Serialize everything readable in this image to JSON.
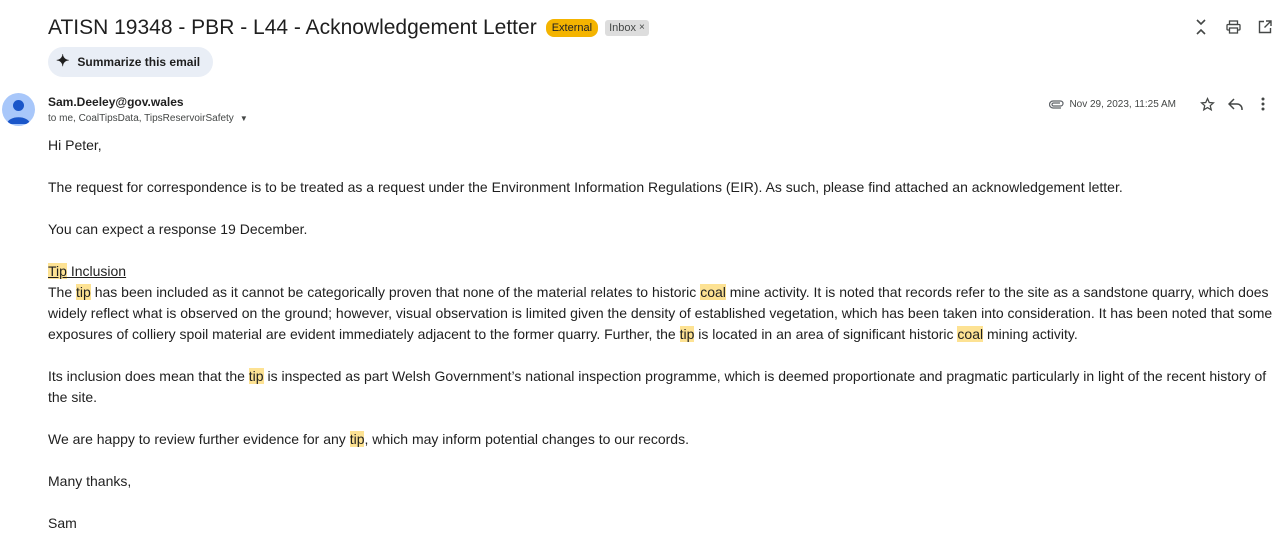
{
  "email": {
    "subject": "ATISN 19348 - PBR - L44 - Acknowledgement Letter",
    "labels": {
      "external": "External",
      "inbox": "Inbox",
      "inbox_remove": "×"
    },
    "summarize_label": "Summarize this email",
    "sender": "Sam.Deeley@gov.wales",
    "recipients": "to me, CoalTipsData, TipsReservoirSafety",
    "date": "Nov 29, 2023, 11:25 AM",
    "body": {
      "greeting": "Hi Peter,",
      "p1": "The request for correspondence is to be treated as a request under the Environment Information Regulations (EIR). As such, please find attached an acknowledgement letter.",
      "p2": "You can expect a response 19 December.",
      "heading_hl": "Tip",
      "heading_rest": " Inclusion",
      "p3": {
        "s1": "The ",
        "h1": "tip",
        "s2": " has been included as it cannot be categorically proven that none of the material relates to historic ",
        "h2": "coal",
        "s3": " mine activity. It is noted that records refer to the site as a sandstone quarry, which does widely reflect what is observed on the ground; however, visual observation is limited given the density of established vegetation, which has been taken into consideration. It has been noted that some exposures of colliery spoil material are evident immediately adjacent to the former quarry. Further, the ",
        "h3": "tip",
        "s4": " is located in an area of significant historic ",
        "h4": "coal",
        "s5": " mining activity."
      },
      "p4": {
        "s1": "Its inclusion does mean that the ",
        "h1": "tip",
        "s2": " is inspected as part Welsh Government’s national inspection programme, which is deemed proportionate and pragmatic particularly in light of the recent history of the site."
      },
      "p5": {
        "s1": "We are happy to review further evidence for any ",
        "h1": "tip",
        "s2": ", which may inform potential changes to our records."
      },
      "closing": "Many thanks,",
      "signature": "Sam"
    }
  },
  "colors": {
    "highlight": "#fde293",
    "external_badge": "#f4b400",
    "summarize_bg": "#e9eef6",
    "avatar": "#a8c7fa"
  },
  "icons": {
    "toolbar": [
      "collapse-all-icon",
      "print-icon",
      "open-in-new-window-icon"
    ],
    "summarize": "sparkle-icon",
    "meta": [
      "attachment-icon",
      "star-icon",
      "reply-icon",
      "more-vert-icon"
    ],
    "avatar": "default-avatar-icon"
  }
}
